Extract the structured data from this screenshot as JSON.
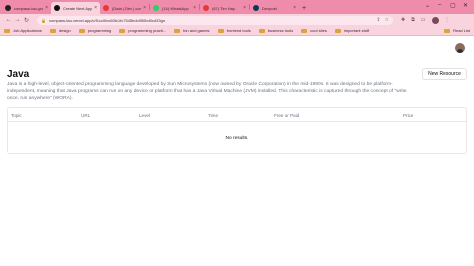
{
  "tabs": [
    {
      "label": "compass-tau-grc",
      "icon": "github-icon",
      "color": "#222222"
    },
    {
      "label": "Create Next App",
      "icon": "nextjs-icon",
      "color": "#111111",
      "active": true
    },
    {
      "label": "(Data | Dev | concept",
      "icon": "youtube-icon",
      "color": "#e53935"
    },
    {
      "label": "(14) WhatsApp",
      "icon": "whatsapp-icon",
      "color": "#25d366"
    },
    {
      "label": "(67) Tim Hay",
      "icon": "youtube-icon",
      "color": "#e53935"
    },
    {
      "label": "Devpost",
      "icon": "devpost-icon",
      "color": "#003e54"
    }
  ],
  "toolbar": {
    "url": "compass-tau.vercel.app/c/f1cc0fcc60fc1fc7545bdc950bd0cd33gn"
  },
  "bookmarks": [
    {
      "label": "Job Applications"
    },
    {
      "label": "design"
    },
    {
      "label": "programming"
    },
    {
      "label": "programming practi..."
    },
    {
      "label": "fun and games"
    },
    {
      "label": "frontend tools"
    },
    {
      "label": "business tools"
    },
    {
      "label": "cool sites"
    },
    {
      "label": "important stuff"
    },
    {
      "label": "Read List"
    }
  ],
  "page": {
    "title": "Java",
    "new_resource_label": "New Resource",
    "description": "Java is a high-level, object-oriented programming language developed by Sun Microsystems (now owned by Oracle Corporation) in the mid-1990s. It was designed to be platform-independent, meaning that Java programs can run on any device or platform that has a Java Virtual Machine (JVM) installed. This characteristic is captured through the concept of \"write once, run anywhere\" (WORA).",
    "columns": [
      "Topic",
      "URL",
      "Level",
      "Time",
      "Free or Paid",
      "Price"
    ],
    "empty_text": "No results."
  }
}
